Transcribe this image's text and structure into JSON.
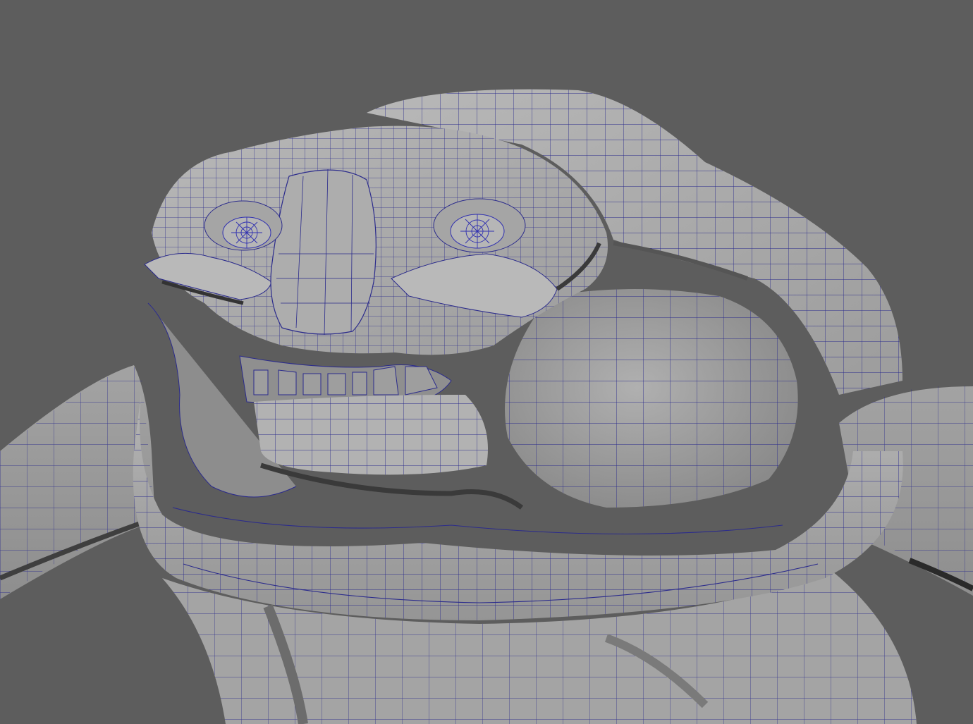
{
  "viewport": {
    "background_color": "#5d5d5d",
    "mesh_fill_color": "#a9a9a9",
    "mesh_shadow_color": "#6e6e6e",
    "mesh_highlight_color": "#c2c2c2",
    "wireframe_color": "#2b2b8c"
  },
  "model": {
    "icon": "creature-head-wireframe",
    "parts": [
      "body",
      "arm-left",
      "arm-right",
      "neck-collar",
      "cranium",
      "brow",
      "eye-left",
      "eye-right",
      "nose",
      "teeth",
      "jaw"
    ]
  }
}
